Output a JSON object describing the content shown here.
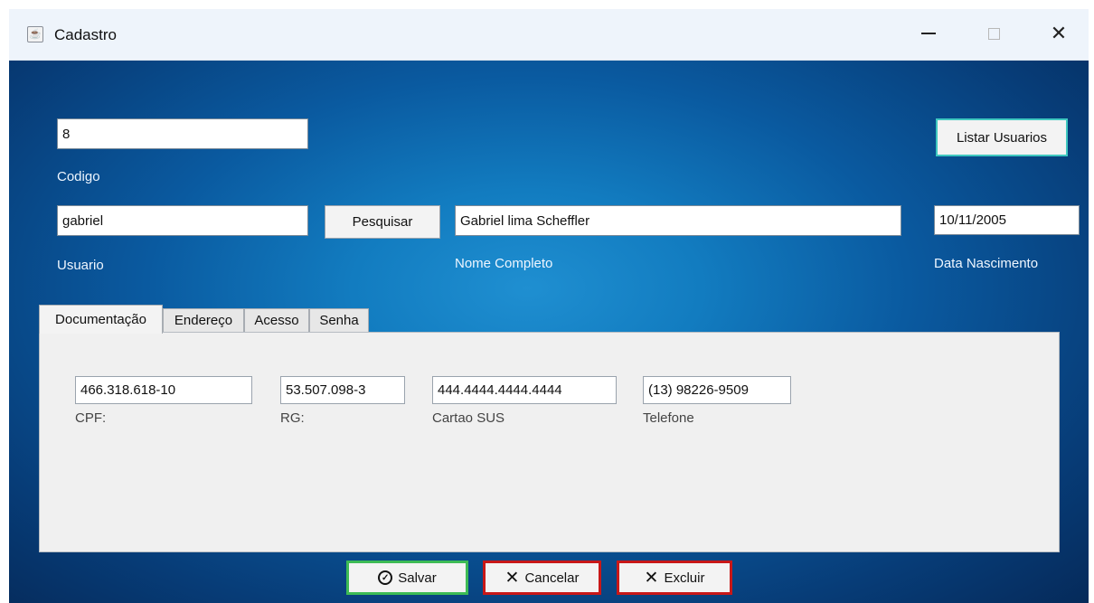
{
  "window": {
    "title": "Cadastro",
    "icons": {
      "app": "java-icon",
      "minimize": "minimize-icon",
      "maximize": "maximize-icon",
      "close": "close-icon"
    }
  },
  "form": {
    "codigo": {
      "value": "8",
      "label": "Codigo"
    },
    "usuario": {
      "value": "gabriel",
      "label": "Usuario"
    },
    "pesquisar_label": "Pesquisar",
    "nome_completo": {
      "value": "Gabriel lima Scheffler",
      "label": "Nome Completo"
    },
    "data_nascimento": {
      "value": "10/11/2005",
      "label": "Data Nascimento"
    },
    "listar_usuarios_label": "Listar Usuarios"
  },
  "tabs": [
    {
      "label": "Documentação",
      "active": true
    },
    {
      "label": "Endereço",
      "active": false
    },
    {
      "label": "Acesso",
      "active": false
    },
    {
      "label": "Senha",
      "active": false
    }
  ],
  "documentacao": {
    "cpf": {
      "value": "466.318.618-10",
      "label": "CPF:"
    },
    "rg": {
      "value": "53.507.098-3",
      "label": "RG:"
    },
    "cartao_sus": {
      "value": "444.4444.4444.4444",
      "label": "Cartao SUS"
    },
    "telefone": {
      "value": "(13) 98226-9509",
      "label": "Telefone"
    }
  },
  "actions": {
    "salvar": {
      "label": "Salvar",
      "icon": "check-circle-icon",
      "color": "#3dbb55"
    },
    "cancelar": {
      "label": "Cancelar",
      "icon": "x-icon",
      "color": "#c81818"
    },
    "excluir": {
      "label": "Excluir",
      "icon": "x-icon",
      "color": "#c81818"
    }
  }
}
